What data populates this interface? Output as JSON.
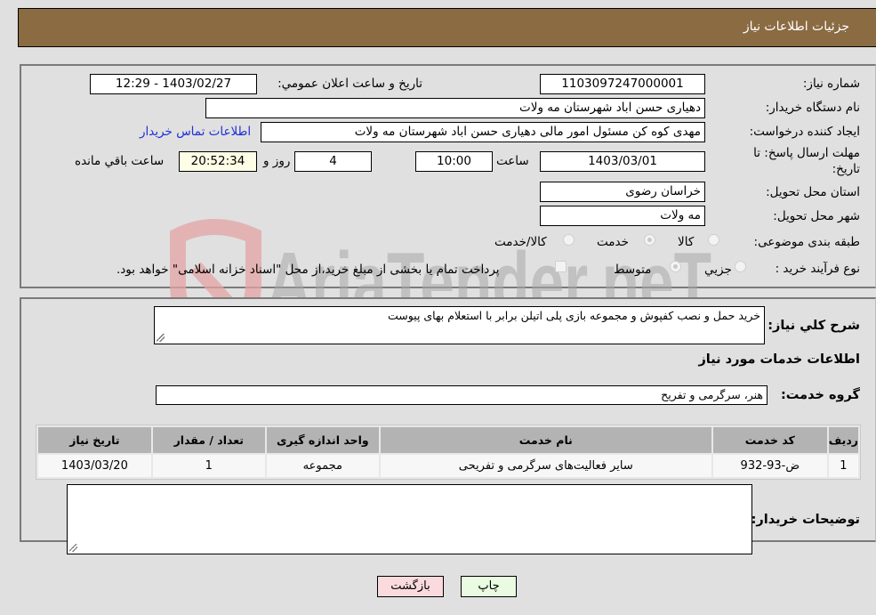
{
  "header": {
    "title": "جزئیات اطلاعات نیاز"
  },
  "details": {
    "need_number": {
      "label": "شماره نیاز:",
      "value": "1103097247000001"
    },
    "announce_datetime": {
      "label": "تاريخ و ساعت اعلان عمومي:",
      "value": "1403/02/27 - 12:29"
    },
    "buyer_org": {
      "label": "نام دستگاه خريدار:",
      "value": "دهیاری حسن اباد شهرستان مه ولات"
    },
    "requester": {
      "label": "ايجاد کننده درخواست:",
      "value": "مهدی کوه کن مسئول امور مالی دهیاری حسن اباد شهرستان مه ولات"
    },
    "contact_link": "اطلاعات تماس خريدار",
    "deadline": {
      "label_line1": "مهلت ارسال پاسخ: تا",
      "label_line2": "تاریخ:",
      "date": "1403/03/01",
      "time_label": "ساعت",
      "time": "10:00",
      "days": "4",
      "days_label": "روز و",
      "remaining": "20:52:34",
      "remaining_label": "ساعت باقي مانده"
    },
    "province": {
      "label": "استان محل تحویل:",
      "value": "خراسان رضوی"
    },
    "city": {
      "label": "شهر محل تحویل:",
      "value": "مه ولات"
    },
    "category": {
      "label": "طبقه بندی موضوعی:",
      "options": [
        "کالا",
        "خدمت",
        "کالا/خدمت"
      ],
      "selected": "خدمت"
    },
    "process": {
      "label": "نوع فرآيند خريد :",
      "options": [
        "جزيي",
        "متوسط"
      ],
      "selected": "متوسط",
      "treasury_note": "پرداخت تمام يا بخشی از مبلغ خريد،از محل \"اسناد خزانه اسلامی\" خواهد بود."
    }
  },
  "services": {
    "summary_label": "شرح كلي نياز:",
    "summary_text": "خرید حمل و نصب کفپوش و مجموعه بازی پلی اتیلن  برابر با استعلام بهای پیوست",
    "section_title": "اطلاعات خدمات مورد نياز",
    "group_label": "گروه خدمت:",
    "group_value": "هنر، سرگرمی و تفریح",
    "table": {
      "columns": [
        "رديف",
        "كد خدمت",
        "نام خدمت",
        "واحد اندازه گیری",
        "تعداد / مقدار",
        "تاريخ نياز"
      ],
      "rows": [
        [
          "1",
          "ض-93-932",
          "سایر فعالیت‌های سرگرمی و تفریحی",
          "مجموعه",
          "1",
          "1403/03/20"
        ]
      ]
    },
    "buyer_notes_label": "توضيحات خريدار:",
    "buyer_notes_value": ""
  },
  "buttons": {
    "print": "چاپ",
    "back": "بازگشت"
  },
  "watermark": {
    "text": "AriaTender.neT"
  }
}
